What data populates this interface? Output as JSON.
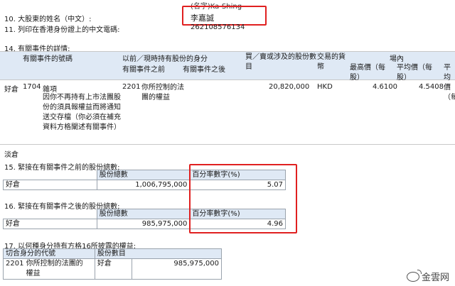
{
  "header_fragment": "(名字)Ka-Shing",
  "item10": {
    "label": "10. 大股東的姓名（中文）:",
    "value": "李嘉誠"
  },
  "item11": {
    "label": "11. 列印在香港身份證上的中文電碼:",
    "value": "262108576134"
  },
  "item14": {
    "label": "14. 有關事件的詳情:",
    "headers": {
      "event_code": "有關事件的號碼",
      "capacity": "以前／現時持有股份的身分",
      "before": "有關事件之前",
      "after": "有關事件之後",
      "shares": "買／賣或涉及的股份數目",
      "currency": "交易的貨幣",
      "onmarket": "場內",
      "high": "最高價（每股）",
      "avg": "平均價（每股）",
      "avg2": "平均價（每"
    },
    "row": {
      "position": "好倉",
      "code": "1704",
      "event_title": "雜項",
      "event_desc": "因你不再持有上市法團股份的須具報權益而將通知送交存檔（你必須在補充資料方格闡述有關事件）",
      "cap_code": "2201",
      "cap_desc": "你所控制的法團的權益",
      "shares": "20,820,000",
      "currency": "HKD",
      "high": "4.6100",
      "avg": "4.5408"
    },
    "short_label": "淡倉"
  },
  "item15": {
    "label": "15. 緊接在有關事件之前的股份總數:",
    "col_shares": "股份總數",
    "col_pct": "百分率數字(%)",
    "row_label": "好倉",
    "shares": "1,006,795,000",
    "pct": "5.07"
  },
  "item16": {
    "label": "16. 緊接在有關事件之後的股份總數:",
    "col_shares": "股份總數",
    "col_pct": "百分率數字(%)",
    "row_label": "好倉",
    "shares": "985,975,000",
    "pct": "4.96"
  },
  "item17": {
    "label": "17. 以何種身分持有方格16所披露的權益:",
    "col_code": "切合身分的代號",
    "col_shares": "股份數目",
    "code": "2201",
    "desc": "你所控制的法團的權益",
    "pos": "好倉",
    "shares": "985,975,000"
  },
  "watermark": "金雲网",
  "accent_red": "#e02020"
}
